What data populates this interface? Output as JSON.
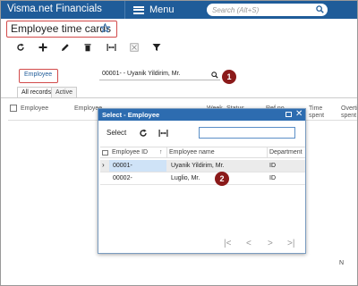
{
  "app": {
    "brand": "Visma.net Financials",
    "menu_label": "Menu",
    "search_placeholder": "Search (Alt+S)"
  },
  "page": {
    "title": "Employee time cards"
  },
  "toolbar": {
    "tools": [
      "refresh-icon",
      "add-icon",
      "edit-icon",
      "delete-icon",
      "fit-columns-icon",
      "export-icon",
      "filter-icon"
    ]
  },
  "filter": {
    "label": "Employee",
    "value": "00001- - Uyanik Yildirim, Mr.",
    "badge": "1"
  },
  "tabs": [
    "All records",
    "Active"
  ],
  "grid": {
    "columns": [
      "Employee",
      "Employee",
      "Week",
      "Status",
      "Ref.no",
      "Time spent",
      "Overtime spent"
    ]
  },
  "modal": {
    "title": "Select - Employee",
    "select_label": "Select",
    "search_value": "",
    "columns": [
      "Employee ID",
      "Employee name",
      "Department"
    ],
    "rows": [
      {
        "id": "00001-",
        "name": "Uyanik Yildirim, Mr.",
        "dept": "ID"
      },
      {
        "id": "00002-",
        "name": "Luglio, Mr.",
        "dept": "ID"
      }
    ],
    "badge": "2",
    "pager": [
      "|<",
      "<",
      ">",
      ">|"
    ]
  },
  "stray_text": "N",
  "colors": {
    "topbar": "#1F5C99",
    "modal_header": "#2D6CB0",
    "annotation": "#8B1A1A"
  }
}
